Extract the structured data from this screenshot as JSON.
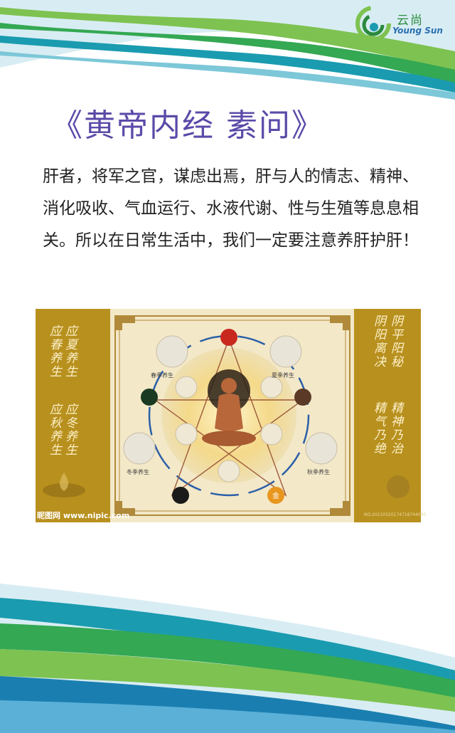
{
  "logo": {
    "cn": "云尚",
    "en": "Young Sun"
  },
  "title": "《黄帝内经  素问》",
  "paragraph": "肝者，将军之官，谋虑出焉，肝与人的情志、精神、消化吸收、气血运行、水液代谢、性与生殖等息息相关。所以在日常生活中，我们一定要注意养肝护肝！",
  "image": {
    "watermark_left": "昵图网 www.nipic.com",
    "watermark_right": "NO:20150520174718744085",
    "calligraphy_left": [
      "应春养生",
      "应夏养生",
      "应秋养生",
      "应冬养生"
    ],
    "calligraphy_right": [
      "阴平阳秘",
      "阴阳离决",
      "精神乃治",
      "精气乃绝"
    ],
    "seasons": [
      "春季养生",
      "夏季养生",
      "秋季养生",
      "冬季养生"
    ],
    "center_char": "金"
  },
  "colors": {
    "title": "#5b4aa8",
    "green": "#5bb045",
    "teal": "#1a9bb0",
    "gold": "#b8901e"
  }
}
